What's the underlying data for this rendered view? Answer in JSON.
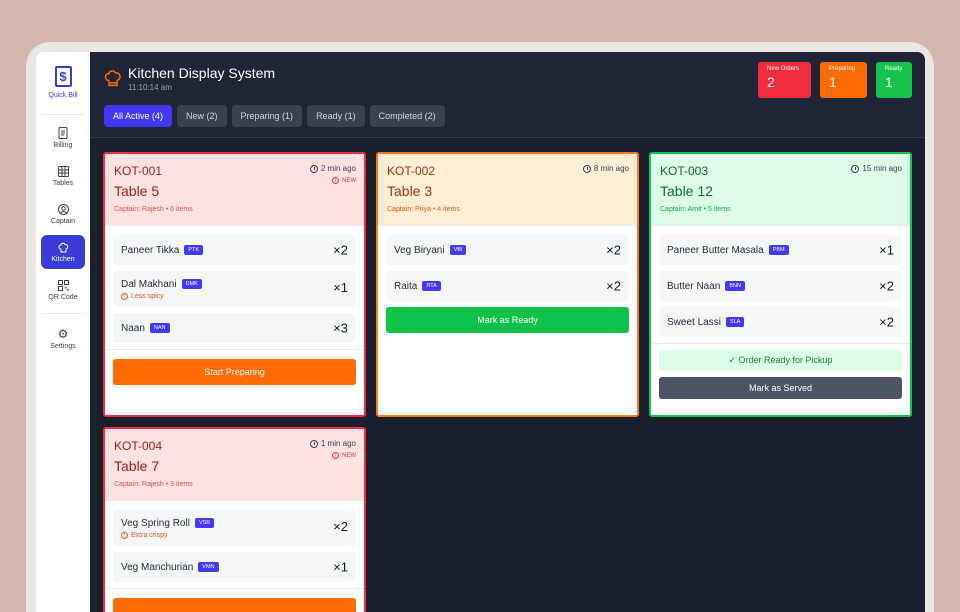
{
  "app": {
    "logo_text": "Quick Bill",
    "title": "Kitchen Display System",
    "time": "11:10:14 am"
  },
  "sidebar": {
    "items": [
      {
        "label": "Billing",
        "icon": "receipt-icon"
      },
      {
        "label": "Tables",
        "icon": "grid-icon"
      },
      {
        "label": "Captain",
        "icon": "user-icon"
      },
      {
        "label": "Kitchen",
        "icon": "chef-hat-icon",
        "active": true
      },
      {
        "label": "QR Code",
        "icon": "qr-code-icon"
      },
      {
        "label": "Settings",
        "icon": "gear-icon"
      }
    ]
  },
  "stats": {
    "new_orders": {
      "label": "New Orders",
      "value": "2"
    },
    "preparing": {
      "label": "Preparing",
      "value": "1"
    },
    "ready": {
      "label": "Ready",
      "value": "1"
    }
  },
  "tabs": [
    "All Active (4)",
    "New (2)",
    "Preparing (1)",
    "Ready (1)",
    "Completed (2)"
  ],
  "orders": [
    {
      "kot": "KOT-001",
      "table": "Table 5",
      "captain": "Captain: Rajesh • 6 items",
      "ago": "2 min ago",
      "badge": "NEW",
      "items": [
        {
          "name": "Paneer Tikka",
          "code": "PTK",
          "qty": "×2"
        },
        {
          "name": "Dal Makhani",
          "code": "DMK",
          "qty": "×1",
          "note": "Less spicy"
        },
        {
          "name": "Naan",
          "code": "NAN",
          "qty": "×3"
        }
      ],
      "action": "Start Preparing"
    },
    {
      "kot": "KOT-002",
      "table": "Table 3",
      "captain": "Captain: Priya • 4 items",
      "ago": "8 min ago",
      "items": [
        {
          "name": "Veg Biryani",
          "code": "VBI",
          "qty": "×2"
        },
        {
          "name": "Raita",
          "code": "RTA",
          "qty": "×2"
        }
      ],
      "action": "Mark as Ready"
    },
    {
      "kot": "KOT-003",
      "table": "Table 12",
      "captain": "Captain: Amit • 5 items",
      "ago": "15 min ago",
      "items": [
        {
          "name": "Paneer Butter Masala",
          "code": "PBM",
          "qty": "×1"
        },
        {
          "name": "Butter Naan",
          "code": "BNN",
          "qty": "×2"
        },
        {
          "name": "Sweet Lassi",
          "code": "SLA",
          "qty": "×2"
        }
      ],
      "status_note": "✓ Order Ready for Pickup",
      "action": "Mark as Served"
    },
    {
      "kot": "KOT-004",
      "table": "Table 7",
      "captain": "Captain: Rajesh • 3 items",
      "ago": "1 min ago",
      "badge": "NEW",
      "items": [
        {
          "name": "Veg Spring Roll",
          "code": "VSR",
          "qty": "×2",
          "note": "Extra crispy"
        },
        {
          "name": "Veg Manchurian",
          "code": "VMN",
          "qty": "×1"
        }
      ]
    }
  ],
  "colors": {
    "accent": "#4338f5",
    "new": "#ef2d3d",
    "preparing": "#ff6b00",
    "ready": "#16c44c",
    "background": "#1a1f2e"
  }
}
